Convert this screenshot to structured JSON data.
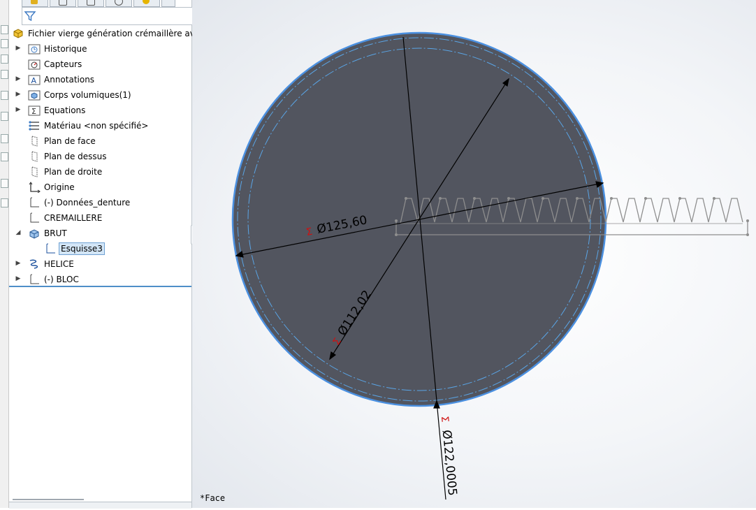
{
  "feature_tree": {
    "root": "Fichier vierge génération crémaillère avec hé",
    "items": [
      {
        "label": "Historique",
        "icon": "history-folder-icon",
        "expandable": true
      },
      {
        "label": "Capteurs",
        "icon": "sensor-icon",
        "expandable": false
      },
      {
        "label": "Annotations",
        "icon": "annotation-icon",
        "expandable": true
      },
      {
        "label": "Corps volumiques(1)",
        "icon": "solid-bodies-icon",
        "expandable": true
      },
      {
        "label": "Equations",
        "icon": "equations-icon",
        "expandable": true
      },
      {
        "label": "Matériau <non spécifié>",
        "icon": "material-icon",
        "expandable": false
      },
      {
        "label": "Plan de face",
        "icon": "plane-icon",
        "expandable": false
      },
      {
        "label": "Plan de dessus",
        "icon": "plane-icon",
        "expandable": false
      },
      {
        "label": "Plan de droite",
        "icon": "plane-icon",
        "expandable": false
      },
      {
        "label": "Origine",
        "icon": "origin-icon",
        "expandable": false
      },
      {
        "label": "(-) Données_denture",
        "icon": "sketch-icon",
        "expandable": false
      },
      {
        "label": "CREMAILLERE",
        "icon": "sketch-icon",
        "expandable": false
      },
      {
        "label": "BRUT",
        "icon": "extrude-icon",
        "expandable": true,
        "expanded": true
      },
      {
        "label": "Esquisse3",
        "icon": "sketch-icon",
        "child": true,
        "selected": true
      },
      {
        "label": "HELICE",
        "icon": "helix-icon",
        "expandable": true
      },
      {
        "label": "(-) BLOC",
        "icon": "sketch-icon",
        "expandable": true
      }
    ]
  },
  "viewport": {
    "dimensions": [
      {
        "symbol": "Σ",
        "value": "Ø125,60"
      },
      {
        "symbol": "Σ",
        "value": "Ø112,02"
      },
      {
        "symbol": "Σ",
        "value": "Ø122,0005"
      }
    ],
    "status": "*Face"
  },
  "colors": {
    "disc": "#52555f",
    "edge": "#4b90e0",
    "construction": "#5aa5e6",
    "rack": "#8e8e8e",
    "equation_symbol": "#d01010",
    "dimension_line": "#000000"
  }
}
